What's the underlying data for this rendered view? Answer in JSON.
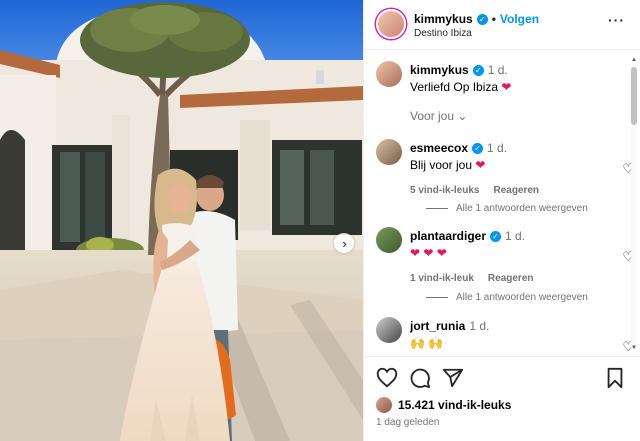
{
  "post": {
    "username": "kimmykus",
    "follow_label": "Volgen",
    "location": "Destino Ibiza",
    "caption_user": "kimmykus",
    "caption_time": "1 d.",
    "caption_text": "Verliefd Op Ibiza",
    "for_you_label": "Voor jou"
  },
  "comments": [
    {
      "user": "esmeecox",
      "time": "1 d.",
      "text": "Blij voor jou",
      "likes": "5 vind-ik-leuks",
      "reply_label": "Reageren",
      "replies_label": "Alle 1 antwoorden weergeven"
    },
    {
      "user": "plantaardiger",
      "time": "1 d.",
      "likes": "1 vind-ik-leuk",
      "reply_label": "Reageren",
      "replies_label": "Alle 1 antwoorden weergeven"
    },
    {
      "user": "jort_runia",
      "time": "1 d."
    }
  ],
  "footer": {
    "likes_count": "15.421 vind-ik-leuks",
    "date": "1 dag geleden"
  },
  "icons": {
    "verified": "verified-badge-icon",
    "heart": "heart-icon",
    "comment": "comment-icon",
    "share": "share-icon",
    "bookmark": "bookmark-icon",
    "more": "more-options-icon",
    "next": "chevron-right-icon"
  },
  "colors": {
    "link_blue": "#0095f6",
    "heart_red": "#e5195a",
    "muted_text": "#737373"
  }
}
